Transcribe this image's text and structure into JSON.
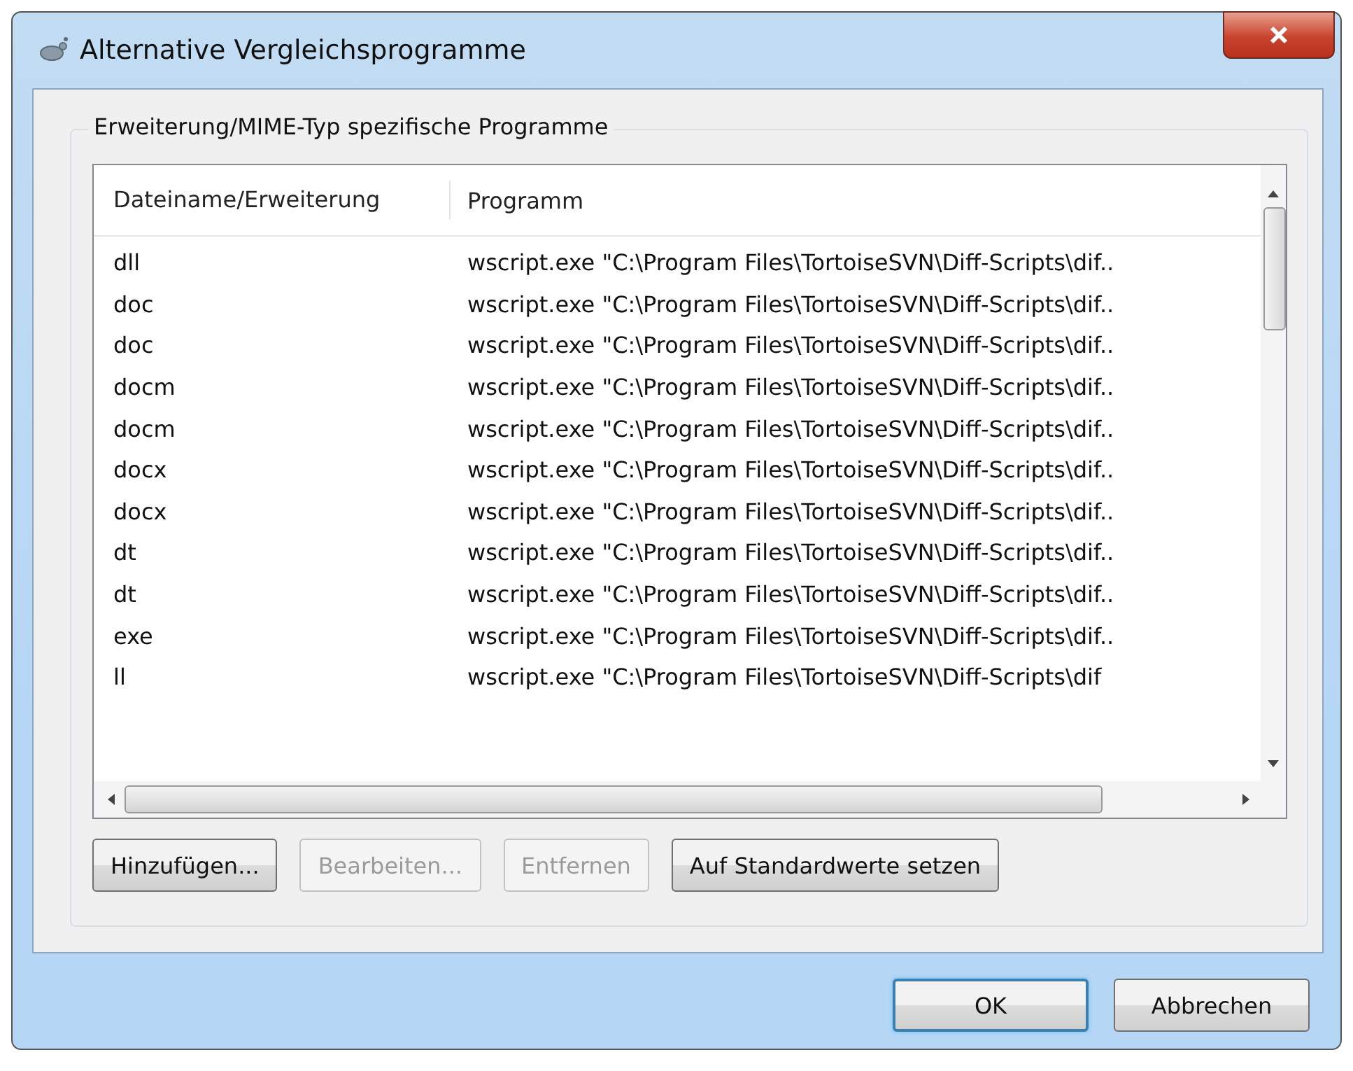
{
  "window": {
    "title": "Alternative Vergleichsprogramme"
  },
  "group": {
    "title": "Erweiterung/MIME-Typ spezifische Programme"
  },
  "table": {
    "columns": [
      "Dateiname/Erweiterung",
      "Programm"
    ],
    "rows": [
      {
        "name": "dll",
        "program": "wscript.exe \"C:\\Program Files\\TortoiseSVN\\Diff-Scripts\\dif.."
      },
      {
        "name": "doc",
        "program": "wscript.exe \"C:\\Program Files\\TortoiseSVN\\Diff-Scripts\\dif.."
      },
      {
        "name": "doc",
        "program": "wscript.exe \"C:\\Program Files\\TortoiseSVN\\Diff-Scripts\\dif.."
      },
      {
        "name": "docm",
        "program": "wscript.exe \"C:\\Program Files\\TortoiseSVN\\Diff-Scripts\\dif.."
      },
      {
        "name": "docm",
        "program": "wscript.exe \"C:\\Program Files\\TortoiseSVN\\Diff-Scripts\\dif.."
      },
      {
        "name": "docx",
        "program": "wscript.exe \"C:\\Program Files\\TortoiseSVN\\Diff-Scripts\\dif.."
      },
      {
        "name": "docx",
        "program": "wscript.exe \"C:\\Program Files\\TortoiseSVN\\Diff-Scripts\\dif.."
      },
      {
        "name": "dt",
        "program": "wscript.exe \"C:\\Program Files\\TortoiseSVN\\Diff-Scripts\\dif.."
      },
      {
        "name": "dt",
        "program": "wscript.exe \"C:\\Program Files\\TortoiseSVN\\Diff-Scripts\\dif.."
      },
      {
        "name": "exe",
        "program": "wscript.exe \"C:\\Program Files\\TortoiseSVN\\Diff-Scripts\\dif.."
      },
      {
        "name": "ll",
        "program": "wscript.exe \"C:\\Program Files\\TortoiseSVN\\Diff-Scripts\\dif"
      }
    ]
  },
  "buttons": [
    {
      "label": "Hinzufügen...",
      "disabled": false
    },
    {
      "label": "Bearbeiten...",
      "disabled": true
    },
    {
      "label": "Entfernen",
      "disabled": true
    },
    {
      "label": "Auf Standardwerte setzen",
      "disabled": false
    }
  ],
  "footer_buttons": [
    {
      "label": "OK",
      "default": true
    },
    {
      "label": "Abbrechen",
      "default": false
    }
  ]
}
